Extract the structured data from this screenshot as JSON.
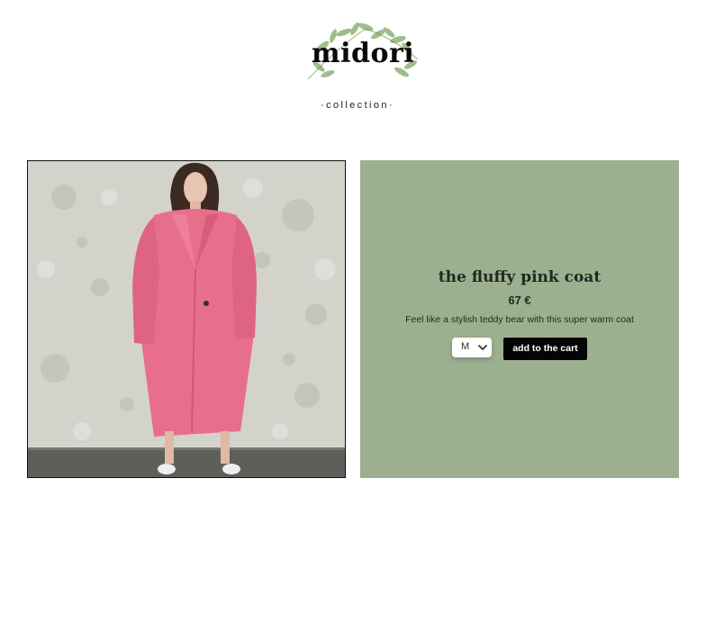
{
  "header": {
    "logo_text": "midori",
    "subtitle": "·collection·"
  },
  "product": {
    "image_alt": "woman wearing a long fluffy pink coat in front of a concrete wall",
    "title": "the fluffy pink coat",
    "price": "67 €",
    "description": "Feel like a stylish teddy bear with this super warm coat",
    "size_selected": "M",
    "add_to_cart_label": "add to the cart"
  },
  "colors": {
    "panel_bg": "#9cb090",
    "button_bg": "#050505",
    "coat": "#e86f8c"
  }
}
